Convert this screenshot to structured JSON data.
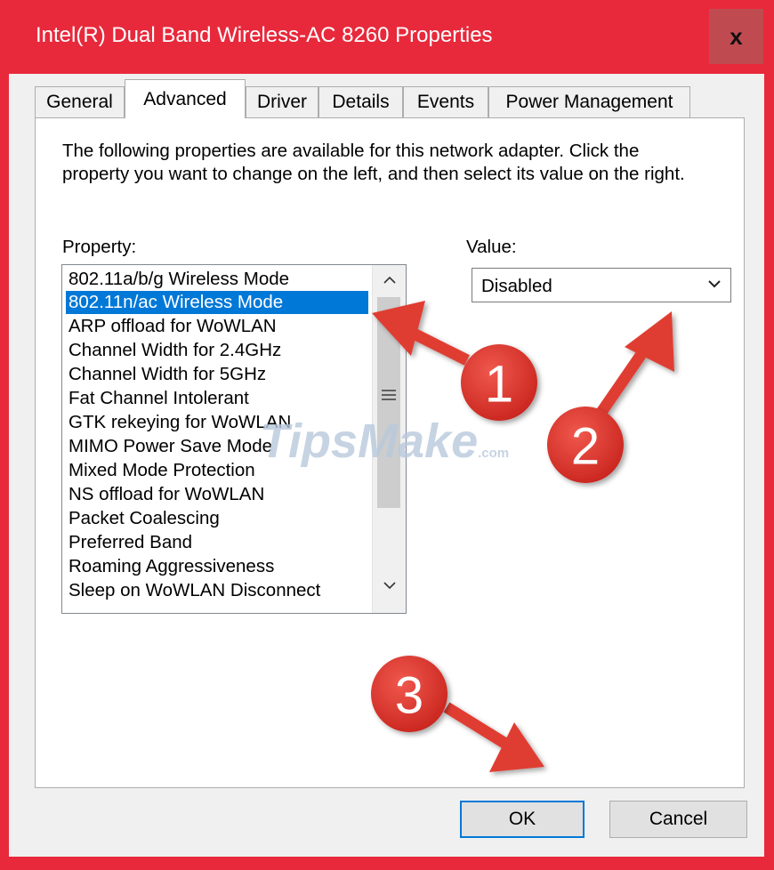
{
  "window": {
    "title": "Intel(R) Dual Band Wireless-AC 8260 Properties",
    "close_label": "x",
    "frame_color": "#e8293b"
  },
  "tabs": [
    {
      "label": "General",
      "active": false
    },
    {
      "label": "Advanced",
      "active": true
    },
    {
      "label": "Driver",
      "active": false
    },
    {
      "label": "Details",
      "active": false
    },
    {
      "label": "Events",
      "active": false
    },
    {
      "label": "Power Management",
      "active": false
    }
  ],
  "advanced": {
    "description": "The following properties are available for this network adapter. Click the property you want to change on the left, and then select its value on the right.",
    "property_label": "Property:",
    "value_label": "Value:",
    "properties": [
      "802.11a/b/g Wireless Mode",
      "802.11n/ac Wireless Mode",
      "ARP offload for WoWLAN",
      "Channel Width for 2.4GHz",
      "Channel Width for 5GHz",
      "Fat Channel Intolerant",
      "GTK rekeying for WoWLAN",
      "MIMO Power Save Mode",
      "Mixed Mode Protection",
      "NS offload for WoWLAN",
      "Packet Coalescing",
      "Preferred Band",
      "Roaming Aggressiveness",
      "Sleep on WoWLAN Disconnect"
    ],
    "selected_property": "802.11n/ac Wireless Mode",
    "value": "Disabled",
    "selection_color": "#0078d7"
  },
  "buttons": {
    "ok": "OK",
    "cancel": "Cancel"
  },
  "watermark": {
    "text": "TipsMake",
    "suffix": ".com"
  },
  "annotations": {
    "badge_color": "#e03c31",
    "steps": [
      "1",
      "2",
      "3"
    ]
  }
}
